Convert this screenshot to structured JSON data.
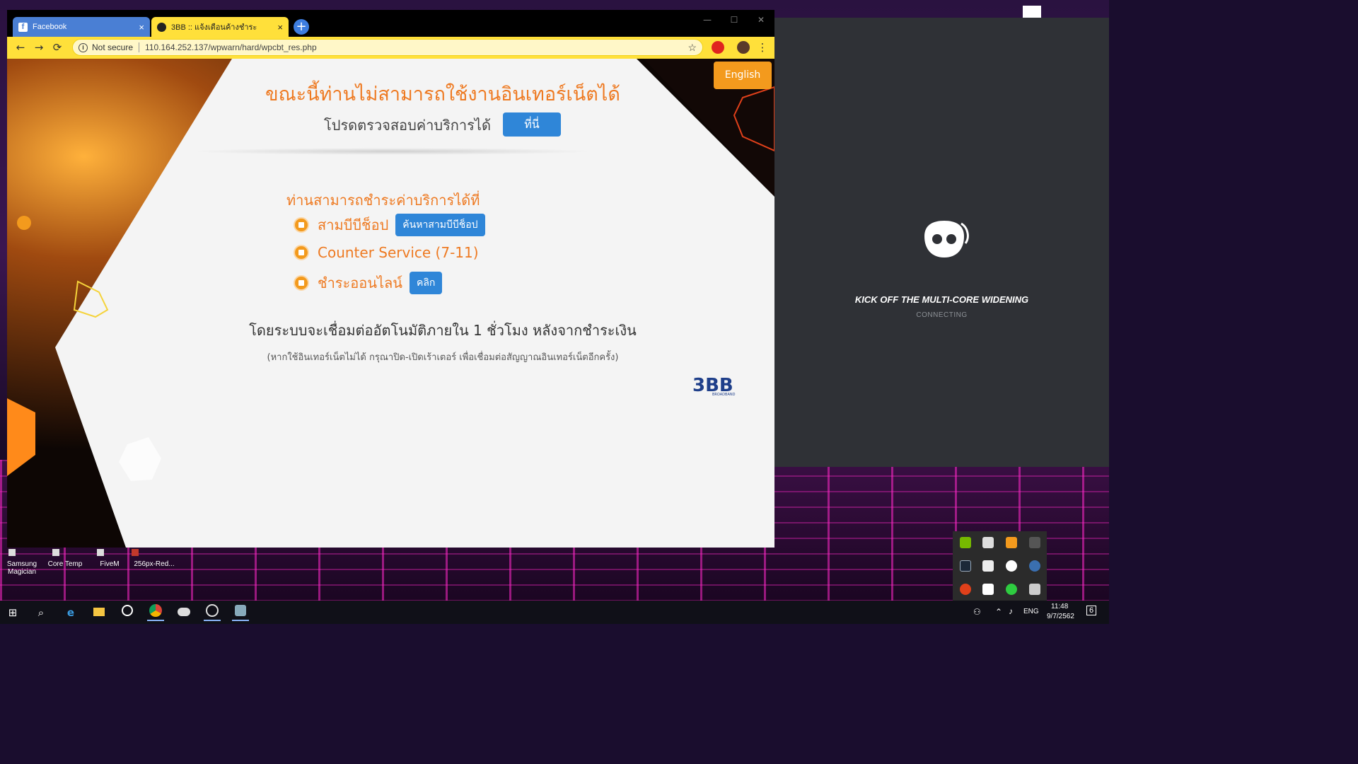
{
  "desktop": {
    "icons": [
      {
        "label": "Samsung Magician"
      },
      {
        "label": "Core Temp"
      },
      {
        "label": "FiveM"
      },
      {
        "label": "256px-Red..."
      }
    ]
  },
  "discord": {
    "title": "KICK OFF THE MULTI-CORE WIDENING",
    "status": "CONNECTING"
  },
  "browser": {
    "tabs": [
      {
        "title": "Facebook",
        "close": "×"
      },
      {
        "title": "3BB :: แจ้งเตือนค้างชำระ",
        "close": "×"
      }
    ],
    "new_tab": "+",
    "window_controls": {
      "minimize": "—",
      "maximize": "☐",
      "close": "✕"
    },
    "nav": {
      "back": "←",
      "forward": "→",
      "reload": "⟳"
    },
    "omnibox": {
      "security": "Not secure",
      "url": "110.164.252.137/wpwarn/hard/wpcbt_res.php",
      "star": "☆"
    },
    "menu": "⋮"
  },
  "page": {
    "language_button": "English",
    "headline": "ขณะนี้ท่านไม่สามารถใช้งานอินเทอร์เน็ตได้",
    "subline": "โปรดตรวจสอบค่าบริการได้",
    "here_button": "ที่นี่",
    "pay_heading": "ท่านสามารถชำระค่าบริการได้ที่",
    "pay_options": [
      {
        "label": "สามบีบีช็อป",
        "button": "ค้นหาสามบีบีช็อป"
      },
      {
        "label": "Counter Service (7-11)",
        "button": ""
      },
      {
        "label": "ชำระออนไลน์",
        "button": "คลิก"
      }
    ],
    "auto_text": "โดยระบบจะเชื่อมต่ออัตโนมัติภายใน 1 ชั่วโมง หลังจากชำระเงิน",
    "note_text": "(หากใช้อินเทอร์เน็ตไม่ได้ กรุณาปิด-เปิดเร้าเตอร์ เพื่อเชื่อมต่อสัญญาณอินเทอร์เน็ตอีกครั้ง)",
    "logo": {
      "brand": "3BB",
      "tag": "BROADBAND"
    }
  },
  "taskbar": {
    "start": "⊞",
    "search": "⌕",
    "language": "ENG",
    "time": "11:48",
    "date": "9/7/2562",
    "notifications": "6"
  },
  "colors": {
    "accent_orange": "#ee7a22",
    "button_blue": "#2f86d8",
    "tab_yellow": "#ffe03a"
  }
}
